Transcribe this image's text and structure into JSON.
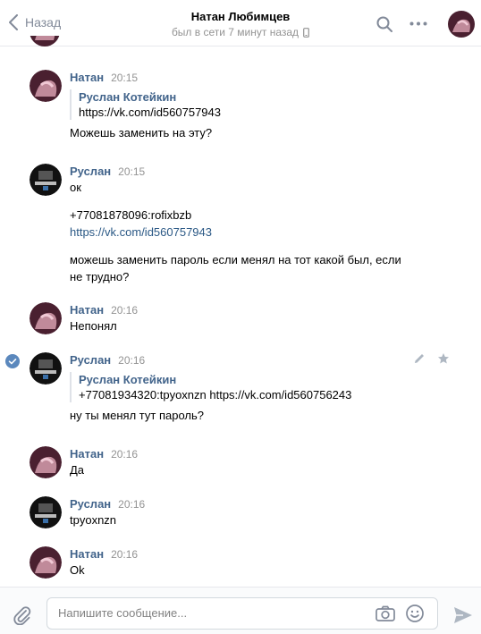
{
  "header": {
    "back_label": "Назад",
    "contact_name": "Натан Любимцев",
    "status": "был в сети 7 минут назад"
  },
  "messages": [
    {
      "author": "Натан",
      "time": "20:15",
      "forward": {
        "author": "Руслан Котейкин",
        "text": "https://vk.com/id560757943"
      },
      "lines": [
        "Можешь заменить на эту?"
      ]
    },
    {
      "author": "Руслан",
      "time": "20:15",
      "lines": [
        "ок",
        "+77081878096:rofixbzb",
        "https://vk.com/id560757943",
        "можешь заменить пароль если менял на тот какой был, если",
        "не трудно?"
      ]
    },
    {
      "author": "Натан",
      "time": "20:16",
      "lines": [
        "Непонял"
      ]
    },
    {
      "author": "Руслан",
      "time": "20:16",
      "forward": {
        "author": "Руслан Котейкин",
        "text": "+77081934320:tpyoxnzn https://vk.com/id560756243"
      },
      "lines": [
        "ну ты менял тут пароль?"
      ]
    },
    {
      "author": "Натан",
      "time": "20:16",
      "lines": [
        "Да"
      ]
    },
    {
      "author": "Руслан",
      "time": "20:16",
      "lines": [
        "tpyoxnzn"
      ]
    },
    {
      "author": "Натан",
      "time": "20:16",
      "lines": [
        "Ok"
      ]
    }
  ],
  "composer": {
    "placeholder": "Напишите сообщение..."
  },
  "icons": {
    "back": "chevron-left-icon",
    "search": "search-icon",
    "more": "more-icon",
    "online_mobile": "phone-icon",
    "selected": "check-circle-icon",
    "edit": "pencil-icon",
    "favorite": "star-icon",
    "attach": "paperclip-icon",
    "camera": "camera-icon",
    "emoji": "smile-icon",
    "send": "send-icon"
  },
  "colors": {
    "link": "#2a5885",
    "author": "#42648b",
    "muted": "#939393",
    "icon": "#828a99",
    "selected": "#5b88bd"
  }
}
